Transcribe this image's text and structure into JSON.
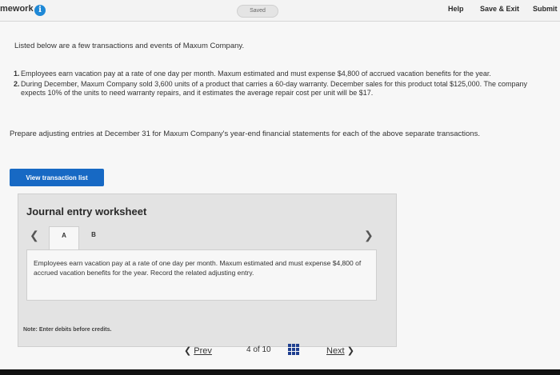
{
  "topbar": {
    "app_title": "mework",
    "saved_label": "Saved",
    "help_label": "Help",
    "save_exit_label": "Save & Exit",
    "submit_label": "Submit"
  },
  "intro": "Listed below are a few transactions and events of Maxum Company.",
  "transactions": [
    {
      "num": "1.",
      "text": "Employees earn vacation pay at a rate of one day per month. Maxum estimated and must expense $4,800 of accrued vacation benefits for the year."
    },
    {
      "num": "2.",
      "text": "During December, Maxum Company sold 3,600 units of a product that carries a 60-day warranty. December sales for this product total $125,000. The company expects 10% of the units to need warranty repairs, and it estimates the average repair cost per unit will be $17."
    }
  ],
  "prompt": "Prepare adjusting entries at December 31 for Maxum Company's year-end financial statements for each of the above separate transactions.",
  "view_button_label": "View transaction list",
  "worksheet": {
    "title": "Journal entry worksheet",
    "tabs": [
      "A",
      "B"
    ],
    "description": "Employees earn vacation pay at a rate of one day per month. Maxum estimated and must expense $4,800 of accrued vacation benefits for the year. Record the related adjusting entry.",
    "note": "Note: Enter debits before credits."
  },
  "pager": {
    "prev_label": "Prev",
    "page_text": "4 of 10",
    "next_label": "Next"
  },
  "colors": {
    "accent": "#1769c4",
    "info_icon": "#1e88d6"
  }
}
